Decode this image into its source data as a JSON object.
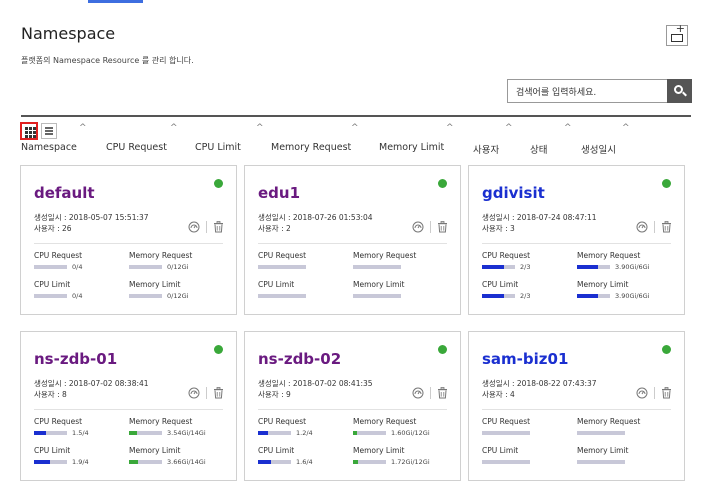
{
  "header": {
    "title": "Namespace",
    "description": "플랫폼의 Namespace Resource 를 관리 합니다."
  },
  "search": {
    "placeholder": "검색어를 입력하세요."
  },
  "columns": [
    {
      "label": "Namespace"
    },
    {
      "label": "CPU Request"
    },
    {
      "label": "CPU Limit"
    },
    {
      "label": "Memory Request"
    },
    {
      "label": "Memory Limit"
    },
    {
      "label": "사용자"
    },
    {
      "label": "상태"
    },
    {
      "label": "생성일시"
    }
  ],
  "labels": {
    "cpu_request": "CPU Request",
    "memory_request": "Memory Request",
    "cpu_limit": "CPU Limit",
    "memory_limit": "Memory Limit"
  },
  "colors": {
    "status_green": "#3aa83a",
    "cpu_bar": "#1a2fd0",
    "mem_bar_green": "#3aa83a",
    "mem_bar_blue": "#1a2fd0",
    "name_purple": "#6a1a80",
    "name_blue": "#1a2fd0"
  },
  "cards": [
    {
      "name": "default",
      "created": "생성일시 : 2018-05-07 15:51:37",
      "users": "사용자 : 26",
      "status": "green",
      "cpu_request": {
        "text": "0/4",
        "fraction": 0
      },
      "memory_request": {
        "text": "0/12Gi",
        "fraction": 0
      },
      "cpu_limit": {
        "text": "0/4",
        "fraction": 0
      },
      "memory_limit": {
        "text": "0/12Gi",
        "fraction": 0
      }
    },
    {
      "name": "edu1",
      "created": "생성일시 : 2018-07-26 01:53:04",
      "users": "사용자 : 2",
      "status": "green",
      "cpu_request": {
        "text": "",
        "fraction": 0
      },
      "memory_request": {
        "text": "",
        "fraction": 0
      },
      "cpu_limit": {
        "text": "",
        "fraction": 0
      },
      "memory_limit": {
        "text": "",
        "fraction": 0
      }
    },
    {
      "name": "gdivisit",
      "created": "생성일시 : 2018-07-24 08:47:11",
      "users": "사용자 : 3",
      "status": "green",
      "cpu_request": {
        "text": "2/3",
        "fraction": 0.67
      },
      "memory_request": {
        "text": "3.90Gi/6Gi",
        "fraction": 0.65
      },
      "cpu_limit": {
        "text": "2/3",
        "fraction": 0.67
      },
      "memory_limit": {
        "text": "3.90Gi/6Gi",
        "fraction": 0.65
      }
    },
    {
      "name": "ns-zdb-01",
      "created": "생성일시 : 2018-07-02 08:38:41",
      "users": "사용자 : 8",
      "status": "green",
      "cpu_request": {
        "text": "1.5/4",
        "fraction": 0.375
      },
      "memory_request": {
        "text": "3.54Gi/14Gi",
        "fraction": 0.25
      },
      "cpu_limit": {
        "text": "1.9/4",
        "fraction": 0.475
      },
      "memory_limit": {
        "text": "3.66Gi/14Gi",
        "fraction": 0.26
      }
    },
    {
      "name": "ns-zdb-02",
      "created": "생성일시 : 2018-07-02 08:41:35",
      "users": "사용자 : 9",
      "status": "green",
      "cpu_request": {
        "text": "1.2/4",
        "fraction": 0.3
      },
      "memory_request": {
        "text": "1.60Gi/12Gi",
        "fraction": 0.13
      },
      "cpu_limit": {
        "text": "1.6/4",
        "fraction": 0.4
      },
      "memory_limit": {
        "text": "1.72Gi/12Gi",
        "fraction": 0.14
      }
    },
    {
      "name": "sam-biz01",
      "created": "생성일시 : 2018-08-22 07:43:37",
      "users": "사용자 : 4",
      "status": "green",
      "cpu_request": {
        "text": "",
        "fraction": 0
      },
      "memory_request": {
        "text": "",
        "fraction": 0
      },
      "cpu_limit": {
        "text": "",
        "fraction": 0
      },
      "memory_limit": {
        "text": "",
        "fraction": 0
      }
    }
  ]
}
